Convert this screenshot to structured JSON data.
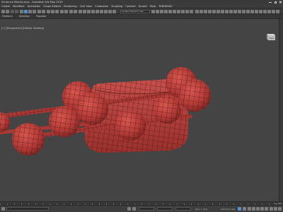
{
  "window": {
    "title": "Sentence Mephis.max - Autodesk 3ds Max 2019"
  },
  "menu": [
    "Create",
    "Modifiers",
    "Animation",
    "Graph Editors",
    "Rendering",
    "Civil View",
    "Customize",
    "Scripting",
    "Content",
    "Arnold",
    "Help",
    "TENGRAVE"
  ],
  "toolbar": {
    "selection_set_placeholder": "Create Selection Set"
  },
  "ribbon": {
    "tabs": [
      "Freeform",
      "Selection",
      "Populate"
    ]
  },
  "viewport": {
    "label": "[+] [Perspective] [Default Shading]",
    "viewcube_face": "Right",
    "background": "#444444",
    "mesh_color": "#b43c3c",
    "wire_color": "#3a0e0e"
  },
  "timeline": {
    "frame_readout": "0 / 100"
  },
  "status": {
    "add_time_tag": "Add Time Tag",
    "coordinate_label": "0 / 100",
    "grid_text": "Grid = 10.0"
  }
}
